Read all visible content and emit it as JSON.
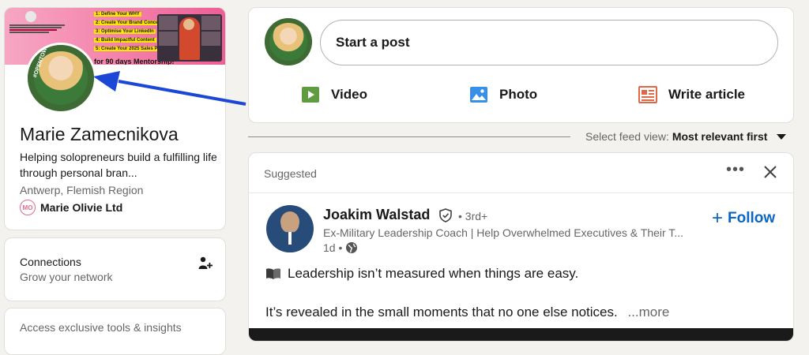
{
  "profile": {
    "name": "Marie Zamecnikova",
    "headline": "Helping solopreneurs build a fulfilling life through personal bran...",
    "location": "Antwerp, Flemish Region",
    "company": "Marie Olivie Ltd",
    "company_logo_text": "MO",
    "avatar_tag": "#OPENTOWORK",
    "banner": {
      "items": [
        "1: Define Your WHY",
        "2: Create Your Brand Concept",
        "3: Optimise Your LinkedIn",
        "4: Build Impactful Content",
        "5: Create Your 2025 Sales Plan"
      ],
      "cta": "for 90 days Mentorship!"
    }
  },
  "connections": {
    "title": "Connections",
    "subtitle": "Grow your network"
  },
  "premium": {
    "text": "Access exclusive tools & insights"
  },
  "share": {
    "placeholder": "Start a post",
    "actions": {
      "video": "Video",
      "photo": "Photo",
      "article": "Write article"
    },
    "colors": {
      "video": "#5f9b41",
      "photo": "#378fe9",
      "article": "#e06847"
    }
  },
  "feed_sort": {
    "label": "Select feed view:",
    "value": "Most relevant first"
  },
  "post": {
    "suggested": "Suggested",
    "author": {
      "name": "Joakim Walstad",
      "degree": "• 3rd+",
      "headline": "Ex-Military Leadership Coach | Help Overwhelmed Executives & Their T...",
      "time": "1d •"
    },
    "follow_label": "Follow",
    "follow_plus": "+",
    "lines": {
      "line1": "Leadership isn’t measured when things are easy.",
      "line2": "It’s revealed in the small moments that no one else notices.",
      "more": "...more"
    }
  },
  "colors": {
    "link_blue": "#0a66c2",
    "arrow_blue": "#1a47d6",
    "background": "#f4f2ee"
  }
}
